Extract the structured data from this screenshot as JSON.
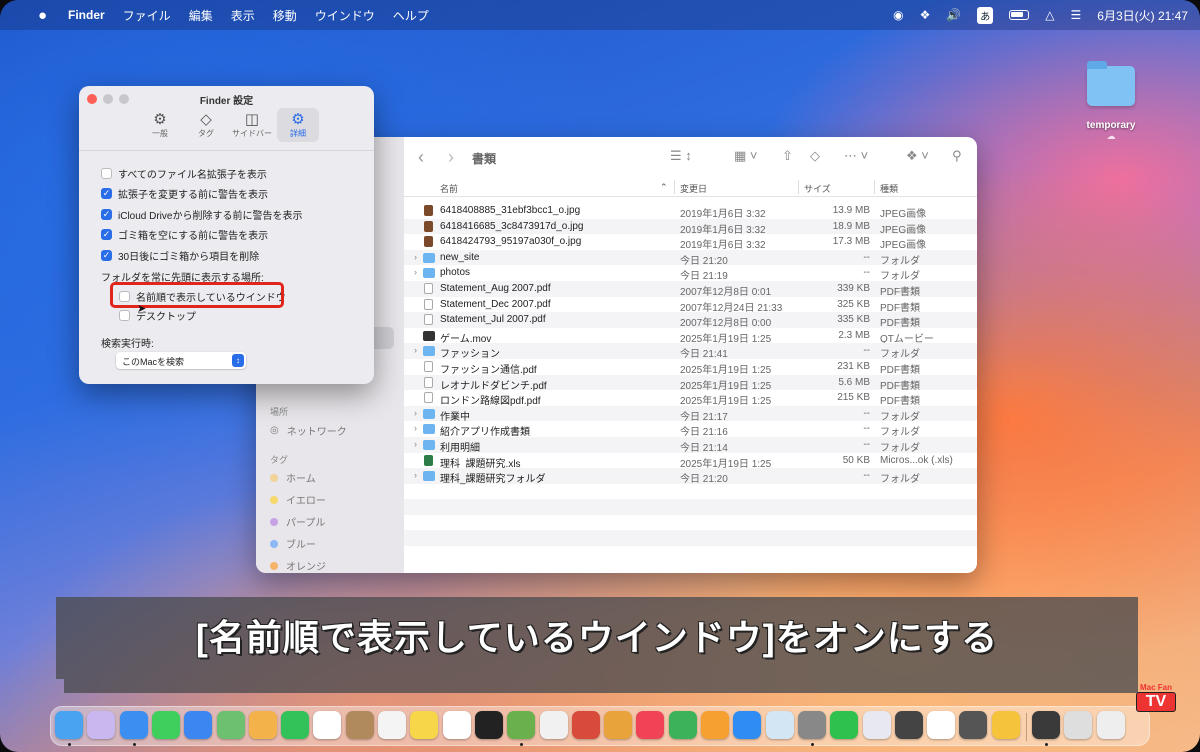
{
  "menubar": {
    "apple_icon": "apple-logo-icon",
    "app_name": "Finder",
    "items": [
      "ファイル",
      "編集",
      "表示",
      "移動",
      "ウインドウ",
      "ヘルプ"
    ],
    "ime": "あ",
    "clock": "6月3日(火) 21:47"
  },
  "desktop": {
    "folder_label": "temporary"
  },
  "settings": {
    "title": "Finder 設定",
    "tabs": [
      {
        "label": "一般",
        "icon": "gear-icon"
      },
      {
        "label": "タグ",
        "icon": "tag-icon"
      },
      {
        "label": "サイドバー",
        "icon": "sidebar-icon"
      },
      {
        "label": "詳細",
        "icon": "gears-icon",
        "active": true
      }
    ],
    "options": [
      {
        "label": "すべてのファイル名拡張子を表示",
        "checked": false
      },
      {
        "label": "拡張子を変更する前に警告を表示",
        "checked": true
      },
      {
        "label": "iCloud Driveから削除する前に警告を表示",
        "checked": true
      },
      {
        "label": "ゴミ箱を空にする前に警告を表示",
        "checked": true
      },
      {
        "label": "30日後にゴミ箱から項目を削除",
        "checked": true
      }
    ],
    "folders_first_label": "フォルダを常に先頭に表示する場所:",
    "folders_first_options": [
      {
        "label": "名前順で表示しているウインドウ",
        "checked": false
      },
      {
        "label": "デスクトップ",
        "checked": false
      }
    ],
    "search_label": "検索実行時:",
    "search_value": "このMacを検索"
  },
  "finder": {
    "title": "書類",
    "columns": {
      "name": "名前",
      "date": "変更日",
      "size": "サイズ",
      "kind": "種類"
    },
    "sidebar": {
      "locations_header": "場所",
      "network": "ネットワーク",
      "tags_header": "タグ",
      "tags": [
        {
          "label": "ホーム",
          "color": "#f1d39a"
        },
        {
          "label": "イエロー",
          "color": "#f6d96a"
        },
        {
          "label": "パープル",
          "color": "#c7a3e6"
        },
        {
          "label": "ブルー",
          "color": "#8cb8f3"
        },
        {
          "label": "オレンジ",
          "color": "#f5b36b"
        }
      ]
    },
    "rows": [
      {
        "type": "img",
        "name": "6418408885_31ebf3bcc1_o.jpg",
        "date": "2019年1月6日 3:32",
        "size": "13.9 MB",
        "kind": "JPEG画像"
      },
      {
        "type": "img",
        "name": "6418416685_3c8473917d_o.jpg",
        "date": "2019年1月6日 3:32",
        "size": "18.9 MB",
        "kind": "JPEG画像"
      },
      {
        "type": "img",
        "name": "6418424793_95197a030f_o.jpg",
        "date": "2019年1月6日 3:32",
        "size": "17.3 MB",
        "kind": "JPEG画像"
      },
      {
        "type": "folder",
        "name": "new_site",
        "date": "今日 21:20",
        "size": "--",
        "kind": "フォルダ"
      },
      {
        "type": "folder",
        "name": "photos",
        "date": "今日 21:19",
        "size": "--",
        "kind": "フォルダ"
      },
      {
        "type": "pdf",
        "name": "Statement_Aug 2007.pdf",
        "date": "2007年12月8日 0:01",
        "size": "339 KB",
        "kind": "PDF書類"
      },
      {
        "type": "pdf",
        "name": "Statement_Dec 2007.pdf",
        "date": "2007年12月24日 21:33",
        "size": "325 KB",
        "kind": "PDF書類"
      },
      {
        "type": "pdf",
        "name": "Statement_Jul 2007.pdf",
        "date": "2007年12月8日 0:00",
        "size": "335 KB",
        "kind": "PDF書類"
      },
      {
        "type": "mov",
        "name": "ゲーム.mov",
        "date": "2025年1月19日 1:25",
        "size": "2.3 MB",
        "kind": "QTムービー"
      },
      {
        "type": "folder",
        "name": "ファッション",
        "date": "今日 21:41",
        "size": "--",
        "kind": "フォルダ"
      },
      {
        "type": "pdf",
        "name": "ファッション通信.pdf",
        "date": "2025年1月19日 1:25",
        "size": "231 KB",
        "kind": "PDF書類"
      },
      {
        "type": "pdf",
        "name": "レオナルドダビンチ.pdf",
        "date": "2025年1月19日 1:25",
        "size": "5.6 MB",
        "kind": "PDF書類"
      },
      {
        "type": "pdf",
        "name": "ロンドン路線図pdf.pdf",
        "date": "2025年1月19日 1:25",
        "size": "215 KB",
        "kind": "PDF書類"
      },
      {
        "type": "folder",
        "name": "作業中",
        "date": "今日 21:17",
        "size": "--",
        "kind": "フォルダ"
      },
      {
        "type": "folder",
        "name": "紹介アプリ作成書類",
        "date": "今日 21:16",
        "size": "--",
        "kind": "フォルダ"
      },
      {
        "type": "folder",
        "name": "利用明細",
        "date": "今日 21:14",
        "size": "--",
        "kind": "フォルダ"
      },
      {
        "type": "xls",
        "name": "理科_課題研究.xls",
        "date": "2025年1月19日 1:25",
        "size": "50 KB",
        "kind": "Micros...ok (.xls)"
      },
      {
        "type": "folder",
        "name": "理科_課題研究フォルダ",
        "date": "今日 21:20",
        "size": "--",
        "kind": "フォルダ"
      }
    ]
  },
  "caption": "[名前順で表示しているウインドウ]をオンにする",
  "watermark": {
    "line1": "Mac Fan",
    "line2": "TV"
  },
  "dock": {
    "apps": [
      {
        "icon": "finder-icon",
        "color": "#4aa3f0",
        "running": true
      },
      {
        "icon": "launchpad-icon",
        "color": "#c9b7f0",
        "running": false
      },
      {
        "icon": "safari-icon",
        "color": "#3a8ff0",
        "running": true
      },
      {
        "icon": "messages-icon",
        "color": "#3ecf5c",
        "running": false
      },
      {
        "icon": "mail-icon",
        "color": "#3c86f2",
        "running": false
      },
      {
        "icon": "maps-icon",
        "color": "#6cc070",
        "running": false
      },
      {
        "icon": "photos-icon",
        "color": "#f4b24a",
        "running": false
      },
      {
        "icon": "facetime-icon",
        "color": "#33c15a",
        "running": false
      },
      {
        "icon": "calendar-icon",
        "color": "#ffffff",
        "running": false
      },
      {
        "icon": "contacts-icon",
        "color": "#b08a5c",
        "running": false
      },
      {
        "icon": "reminders-icon",
        "color": "#f4f4f4",
        "running": false
      },
      {
        "icon": "notes-icon",
        "color": "#f7d64a",
        "running": false
      },
      {
        "icon": "freeform-icon",
        "color": "#ffffff",
        "running": false
      },
      {
        "icon": "tv-icon",
        "color": "#222222",
        "running": false
      },
      {
        "icon": "numbers-app-icon",
        "color": "#6ab04c",
        "running": true
      },
      {
        "icon": "chrome-icon",
        "color": "#f1f1f1",
        "running": false
      },
      {
        "icon": "image-app-icon",
        "color": "#d84a3a",
        "running": false
      },
      {
        "icon": "pages-app-icon",
        "color": "#e8a33a",
        "running": false
      },
      {
        "icon": "music-icon",
        "color": "#f04456",
        "running": false
      },
      {
        "icon": "numbers-icon",
        "color": "#3cb35a",
        "running": false
      },
      {
        "icon": "pages-icon",
        "color": "#f5a030",
        "running": false
      },
      {
        "icon": "app-store-icon",
        "color": "#2f8cf2",
        "running": false
      },
      {
        "icon": "preview-icon",
        "color": "#d2e6f4",
        "running": false
      },
      {
        "icon": "system-settings-icon",
        "color": "#888888",
        "running": true
      },
      {
        "icon": "line-icon",
        "color": "#2fc14e",
        "running": false
      },
      {
        "icon": "affinity-icon",
        "color": "#e8e8f0",
        "running": false
      },
      {
        "icon": "iphone-mirroring-icon",
        "color": "#444444",
        "running": false
      },
      {
        "icon": "chatgpt-icon",
        "color": "#ffffff",
        "running": false
      },
      {
        "icon": "calculator-icon",
        "color": "#555555",
        "running": false
      },
      {
        "icon": "typeless-icon",
        "color": "#f6c43a",
        "running": false
      },
      {
        "icon": "quicktime-icon",
        "color": "#3a3a3a",
        "running": true
      },
      {
        "icon": "downloads-stack-icon",
        "color": "#dedede",
        "running": false
      },
      {
        "icon": "trash-icon",
        "color": "#eeeeee",
        "running": false
      }
    ]
  }
}
